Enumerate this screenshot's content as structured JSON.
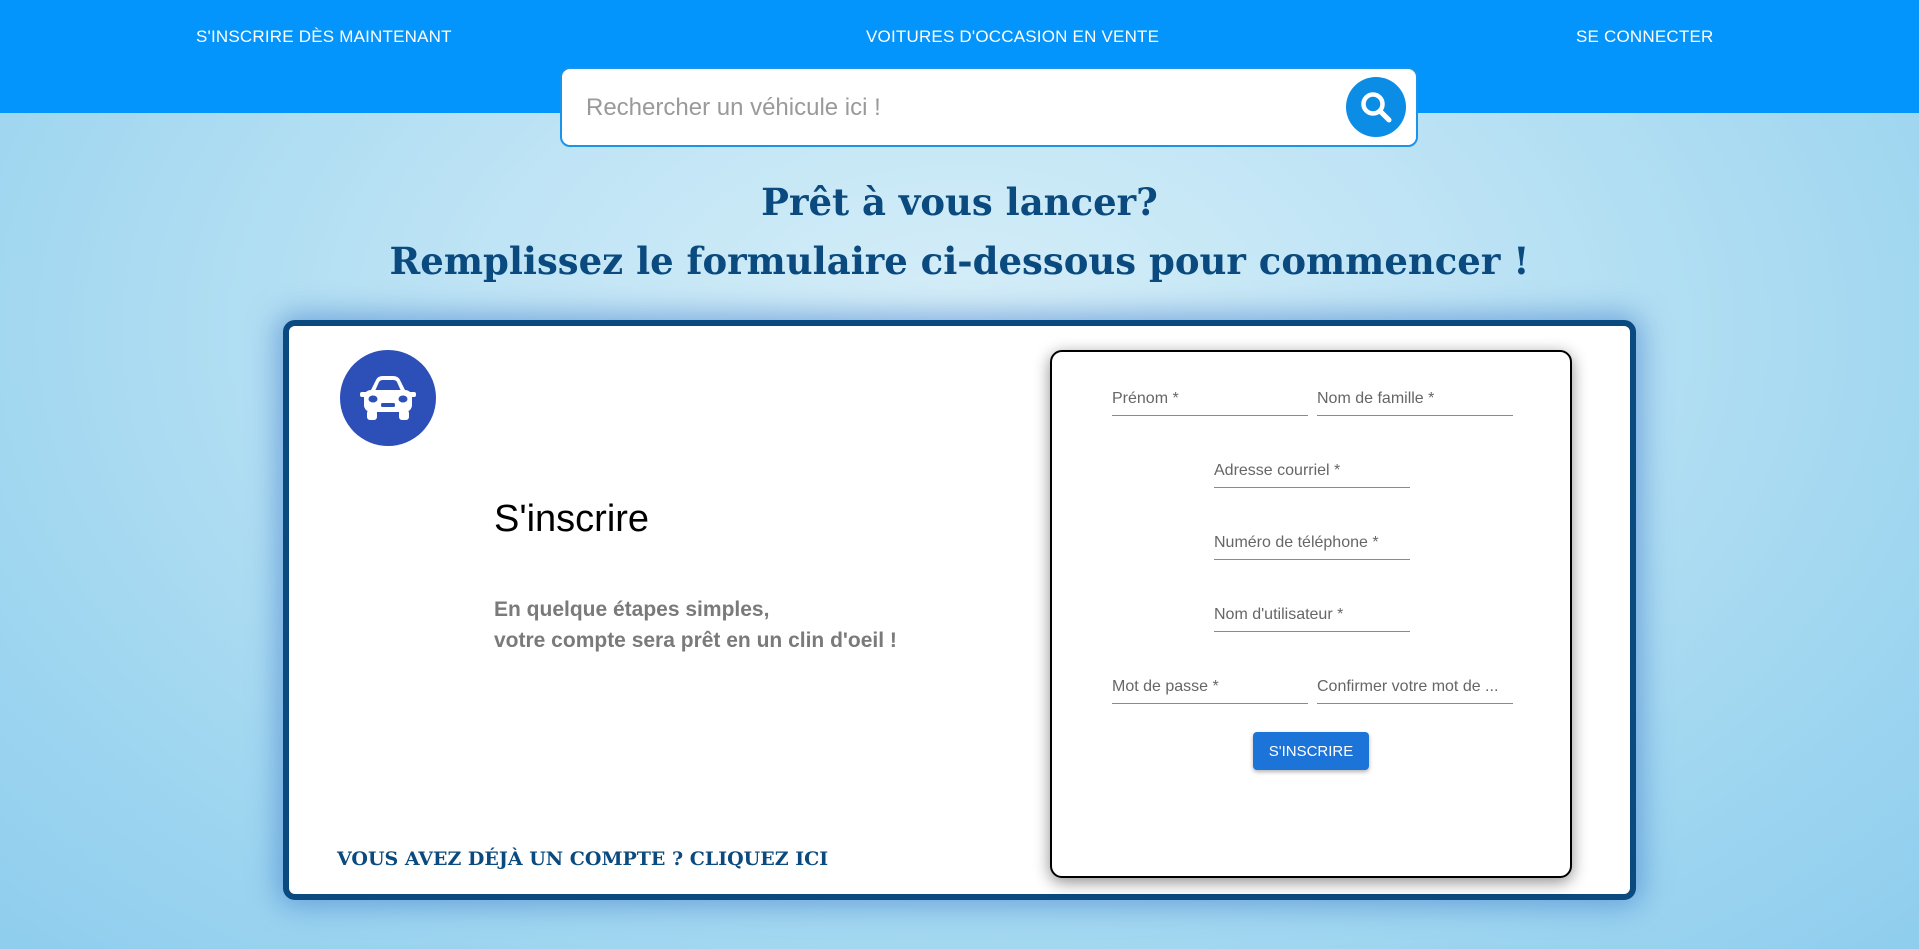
{
  "nav": {
    "signup": "S'INSCRIRE DÈS MAINTENANT",
    "cars": "VOITURES D'OCCASION EN VENTE",
    "login": "SE CONNECTER"
  },
  "search": {
    "placeholder": "Rechercher un véhicule ici !",
    "icon": "search-icon"
  },
  "headline": {
    "line1": "Prêt à vous lancer?",
    "line2": "Remplissez le formulaire ci-dessous pour commencer !"
  },
  "card": {
    "logo_icon": "car-icon",
    "title": "S'inscrire",
    "desc_line1": "En quelque étapes simples,",
    "desc_line2": "votre compte sera prêt en un clin d'oeil !",
    "account_link": "VOUS AVEZ DÉJÀ UN COMPTE ? CLIQUEZ ICI"
  },
  "form": {
    "first_name": "Prénom *",
    "last_name": "Nom de famille *",
    "email": "Adresse courriel *",
    "phone": "Numéro de téléphone *",
    "username": "Nom d'utilisateur *",
    "password": "Mot de passe *",
    "confirm_password": "Confirmer votre mot de ...",
    "submit": "S'INSCRIRE"
  },
  "colors": {
    "header": "#0394fc",
    "headline": "#0a4a7e",
    "logo": "#2d4fb8",
    "button": "#1c74d8"
  }
}
